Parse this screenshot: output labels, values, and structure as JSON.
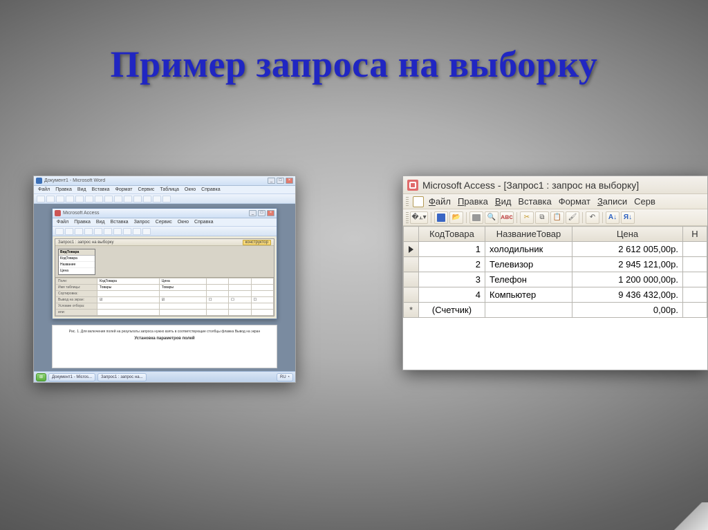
{
  "slide": {
    "title": "Пример запроса на выборку"
  },
  "left": {
    "outer_title": "Документ1 - Microsoft Word",
    "menu": [
      "Файл",
      "Правка",
      "Вид",
      "Вставка",
      "Формат",
      "Сервис",
      "Таблица",
      "Окно",
      "Справка"
    ],
    "inner_title": "Microsoft Access",
    "inner_menu": [
      "Файл",
      "Правка",
      "Вид",
      "Вставка",
      "Запрос",
      "Сервис",
      "Окно",
      "Справка"
    ],
    "design_title": "Запрос1 : запрос на выборку",
    "design_badge": "конструктор",
    "tablebox_title": "ВидТовара",
    "tablebox_fields": [
      "КодТовара",
      "Название",
      "Цена"
    ],
    "grid_rows": [
      "Поле:",
      "Имя таблицы:",
      "Сортировка:",
      "Вывод на экран:",
      "Условие отбора:",
      "или:"
    ],
    "grid_c0": [
      "КодТовара",
      "Товары",
      "",
      "☑",
      "",
      ""
    ],
    "grid_c1": [
      "Цена",
      "Товары",
      "",
      "☑",
      "",
      ""
    ],
    "caption1": "Рис. 1. Для включения полей на результаты запроса нужно взять в соответствующие столбцы флажка Вывод на экран",
    "caption2": "Установка параметров полей",
    "task1": "Документ1 - Micros...",
    "task2": "Запрос1 : запрос на..."
  },
  "right": {
    "title": "Microsoft Access - [Запрос1 : запрос на выборку]",
    "menu": [
      {
        "pre": "Ф",
        "rest": "айл"
      },
      {
        "pre": "П",
        "rest": "равка"
      },
      {
        "pre": "В",
        "rest": "ид"
      },
      {
        "pre": "",
        "rest": "Вставка"
      },
      {
        "pre": "",
        "rest": "Формат"
      },
      {
        "pre": "З",
        "rest": "аписи"
      },
      {
        "pre": "",
        "rest": "Серв"
      }
    ],
    "columns": [
      "КодТовара",
      "НазваниеТовар",
      "Цена",
      "Н"
    ],
    "rows": [
      {
        "id": "1",
        "name": "холодильник",
        "price": "2 612 005,00р."
      },
      {
        "id": "2",
        "name": "Телевизор",
        "price": "2 945 121,00р."
      },
      {
        "id": "3",
        "name": "Телефон",
        "price": "1 200 000,00р."
      },
      {
        "id": "4",
        "name": "Компьютер",
        "price": "9 436 432,00р."
      }
    ],
    "newrow": {
      "id": "(Счетчик)",
      "name": "",
      "price": "0,00р."
    }
  }
}
